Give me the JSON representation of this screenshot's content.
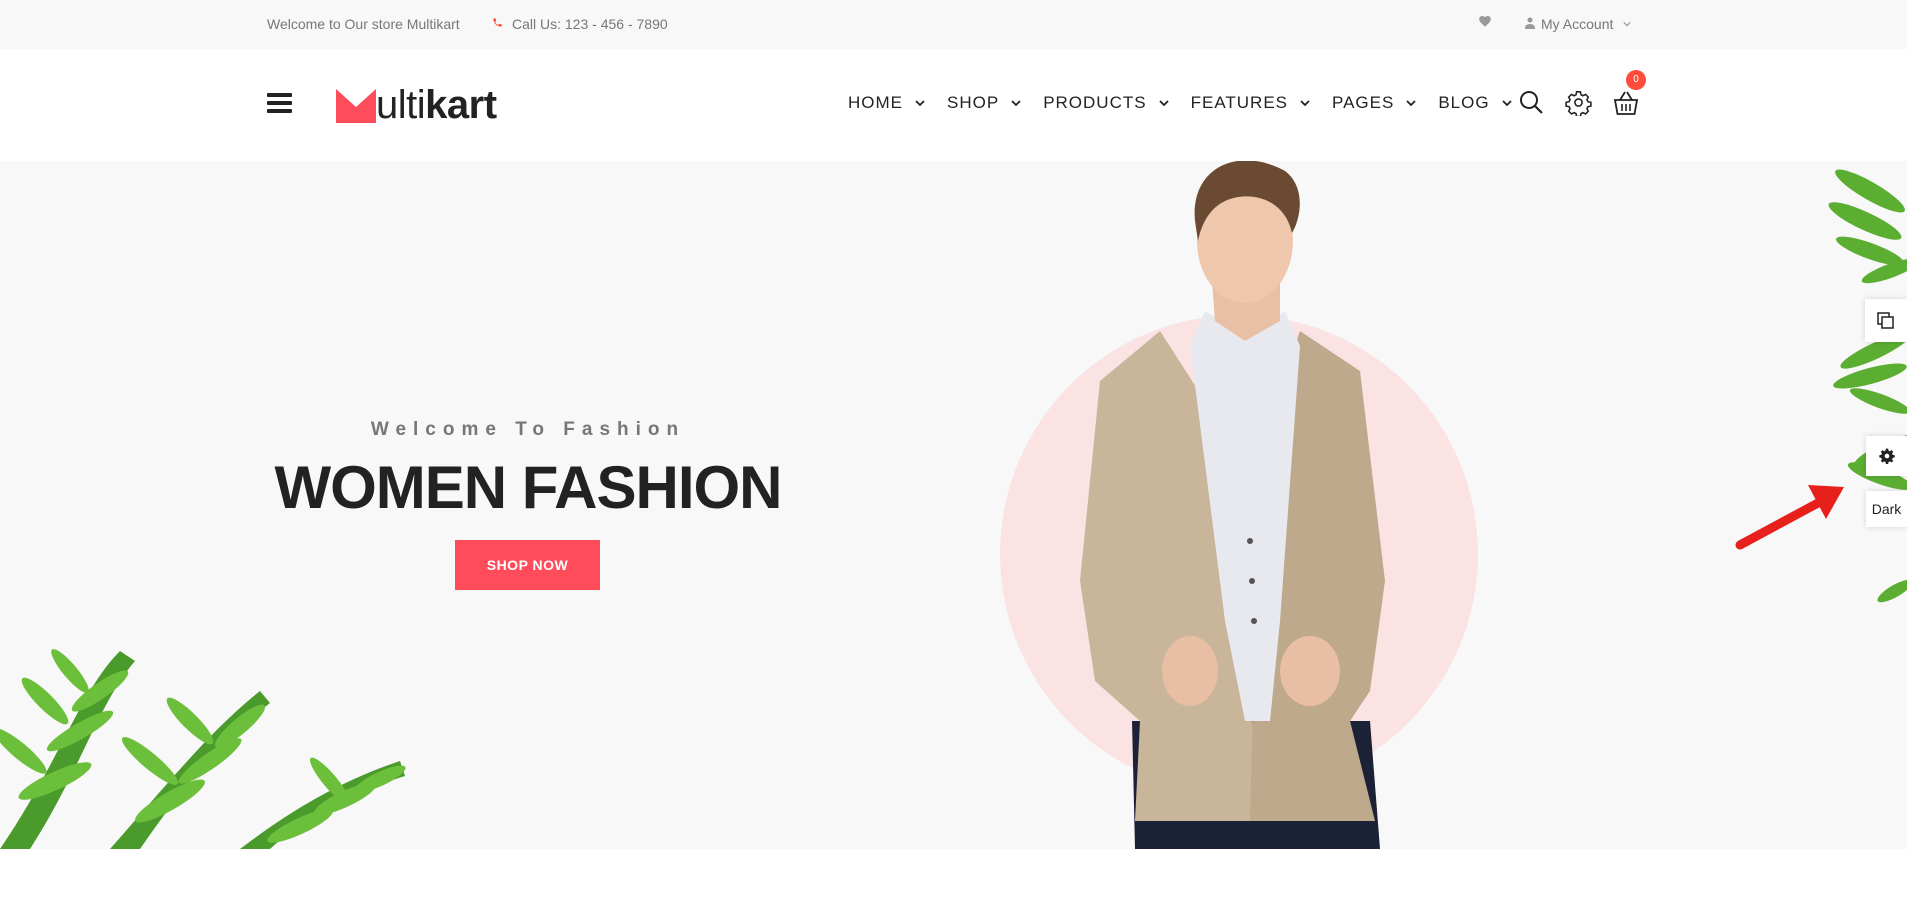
{
  "topbar": {
    "welcome": "Welcome to Our store Multikart",
    "call": "Call Us: 123 - 456 - 7890",
    "account": "My Account"
  },
  "header": {
    "logo_prefix": "ulti",
    "logo_suffix": "kart",
    "nav": [
      {
        "label": "HOME"
      },
      {
        "label": "SHOP"
      },
      {
        "label": "PRODUCTS"
      },
      {
        "label": "FEATURES"
      },
      {
        "label": "PAGES"
      },
      {
        "label": "BLOG"
      }
    ],
    "cart_count": "0"
  },
  "hero": {
    "subtitle": "Welcome To Fashion",
    "title": "WOMEN FASHION",
    "button": "SHOP NOW"
  },
  "side": {
    "dark_label": "Dark"
  },
  "colors": {
    "accent": "#ff4c5b",
    "badge": "#ff4c3b",
    "topbar_bg": "#f8f8f8",
    "hero_bg": "#f8f8f8",
    "circle": "#fbe3e3"
  },
  "icons": [
    "phone-icon",
    "heart-icon",
    "user-icon",
    "chevron-down-icon",
    "hamburger-icon",
    "search-icon",
    "settings-icon",
    "cart-icon",
    "copy-icon",
    "gear-icon"
  ]
}
